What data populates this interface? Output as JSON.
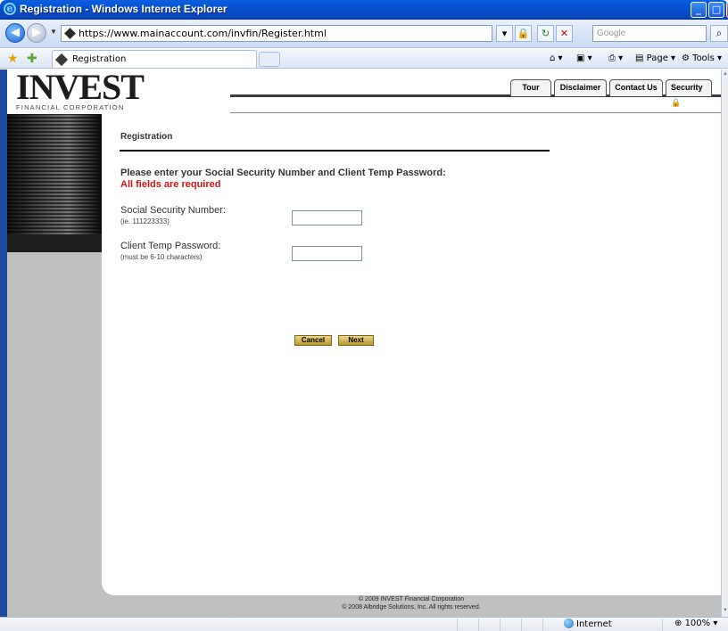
{
  "window": {
    "title": "Registration - Windows Internet Explorer",
    "min_glyph": "_",
    "max_glyph": "□",
    "close_glyph": "X"
  },
  "address_bar": {
    "url": "https://www.mainaccount.com/invfin/Register.html",
    "search_placeholder": "Google"
  },
  "tab_bar": {
    "tab_label": "Registration",
    "commands": {
      "page": "Page",
      "tools": "Tools"
    }
  },
  "site": {
    "logo": {
      "word": "INVEST",
      "subtitle": "FINANCIAL CORPORATION"
    },
    "nav_tabs": [
      "Tour",
      "Disclaimer",
      "Contact Us",
      "Security"
    ]
  },
  "form": {
    "page_title": "Registration",
    "instructions": "Please enter your Social Security Number and Client Temp Password:",
    "required_note": "All fields are required",
    "fields": [
      {
        "label": "Social Security Number:",
        "hint": "(ie. 111223333)",
        "value": ""
      },
      {
        "label": "Client Temp Password:",
        "hint": "(must be 6-10 characters)",
        "value": ""
      }
    ],
    "cancel_label": "Cancel",
    "next_label": "Next"
  },
  "footer": {
    "line1": "© 2009 INVEST Financial Corporation",
    "line2": "© 2008 Albridge Solutions, Inc. All rights reserved."
  },
  "status_bar": {
    "zone": "Internet",
    "zoom": "100%"
  },
  "colors": {
    "required": "#d01414",
    "button_gold": "#c9a93a",
    "titlebar_blue": "#0551d0"
  }
}
